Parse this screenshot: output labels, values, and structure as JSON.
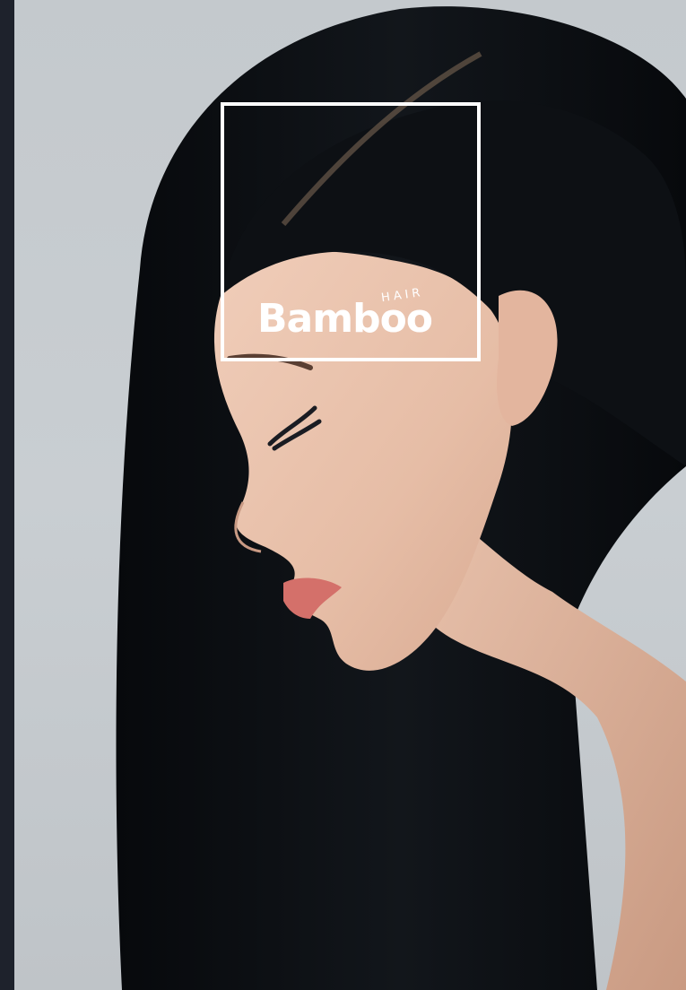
{
  "logo": {
    "wordmark": "Bamboo",
    "subtext": "HAIR",
    "color": "#ffffff"
  },
  "photo": {
    "background_color": "#c6cbcf",
    "hair_color": "#0b0d10",
    "skin_color": "#e8c2ac",
    "lip_color": "#d4706a"
  },
  "frame": {
    "side_strip_color": "#1e222c"
  }
}
